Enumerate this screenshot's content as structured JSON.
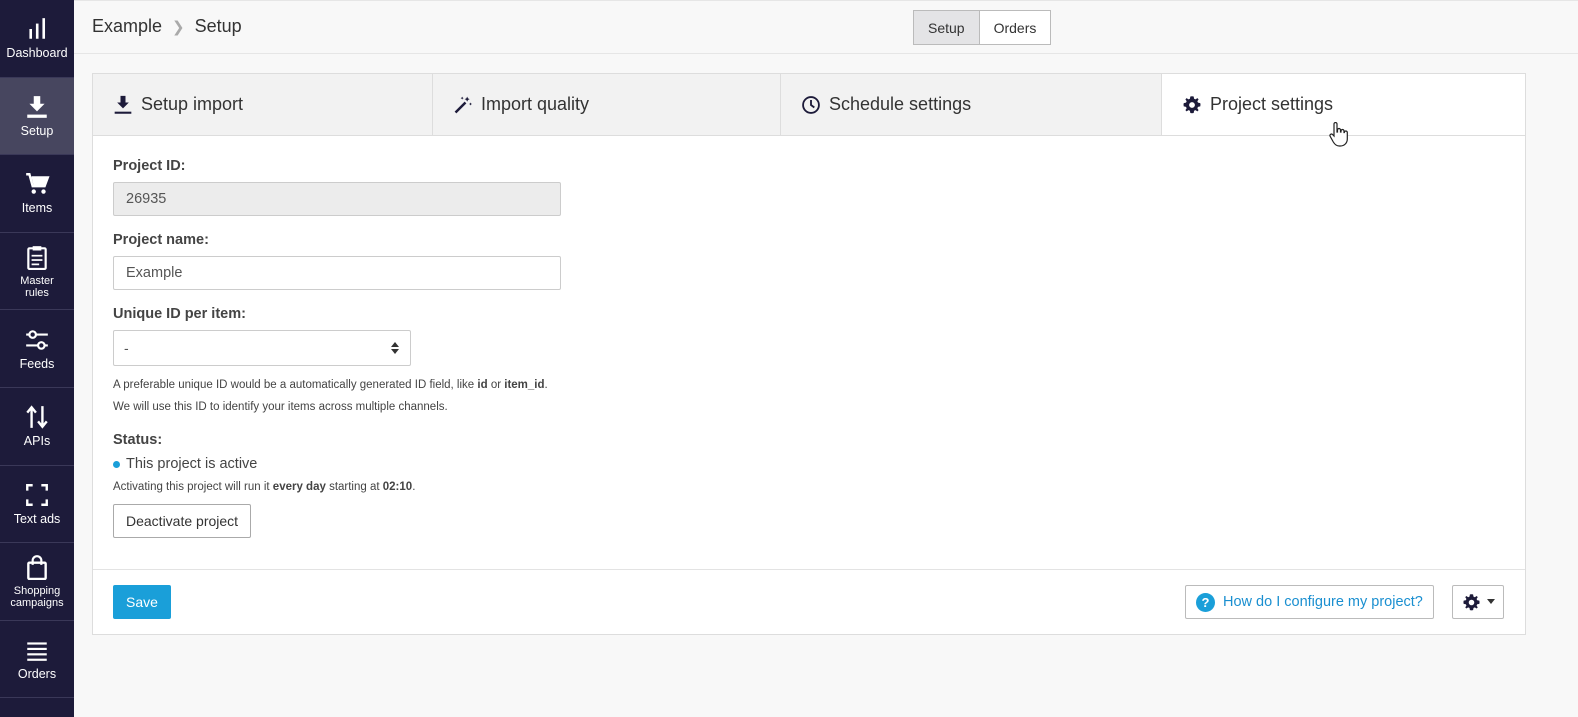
{
  "sidebar": {
    "items": [
      {
        "label": "Dashboard",
        "icon": "bar-chart-icon"
      },
      {
        "label": "Setup",
        "icon": "download-icon"
      },
      {
        "label": "Items",
        "icon": "cart-icon"
      },
      {
        "label": "Master rules",
        "icon": "clipboard-icon"
      },
      {
        "label": "Feeds",
        "icon": "sliders-icon"
      },
      {
        "label": "APIs",
        "icon": "arrows-updown-icon"
      },
      {
        "label": "Text ads",
        "icon": "expand-icon"
      },
      {
        "label": "Shopping campaigns",
        "icon": "shopping-bag-icon"
      },
      {
        "label": "Orders",
        "icon": "list-icon"
      }
    ]
  },
  "breadcrumb": {
    "root": "Example",
    "current": "Setup"
  },
  "toggle": {
    "setup": "Setup",
    "orders": "Orders"
  },
  "tabs": [
    {
      "label": "Setup import",
      "icon": "download-icon"
    },
    {
      "label": "Import quality",
      "icon": "magic-wand-icon"
    },
    {
      "label": "Schedule settings",
      "icon": "clock-icon"
    },
    {
      "label": "Project settings",
      "icon": "gear-icon"
    }
  ],
  "form": {
    "project_id_label": "Project ID:",
    "project_id_value": "26935",
    "project_name_label": "Project name:",
    "project_name_value": "Example",
    "unique_id_label": "Unique ID per item:",
    "unique_id_value": "-",
    "help_line1_a": "A preferable unique ID would be a automatically generated ID field, like ",
    "help_line1_id": "id",
    "help_line1_or": " or ",
    "help_line1_item_id": "item_id",
    "help_line1_end": ".",
    "help_line2": "We will use this ID to identify your items across multiple channels.",
    "status_label": "Status:",
    "status_text": "This project is active",
    "activate_a": "Activating this project will run it ",
    "activate_freq": "every day",
    "activate_b": " starting at ",
    "activate_time": "02:10",
    "activate_end": ".",
    "deactivate_button": "Deactivate project"
  },
  "footer": {
    "save": "Save",
    "help_link": "How do I configure my project?"
  },
  "colors": {
    "sidebar_bg": "#1d1b3a",
    "accent": "#1a9fd9"
  }
}
